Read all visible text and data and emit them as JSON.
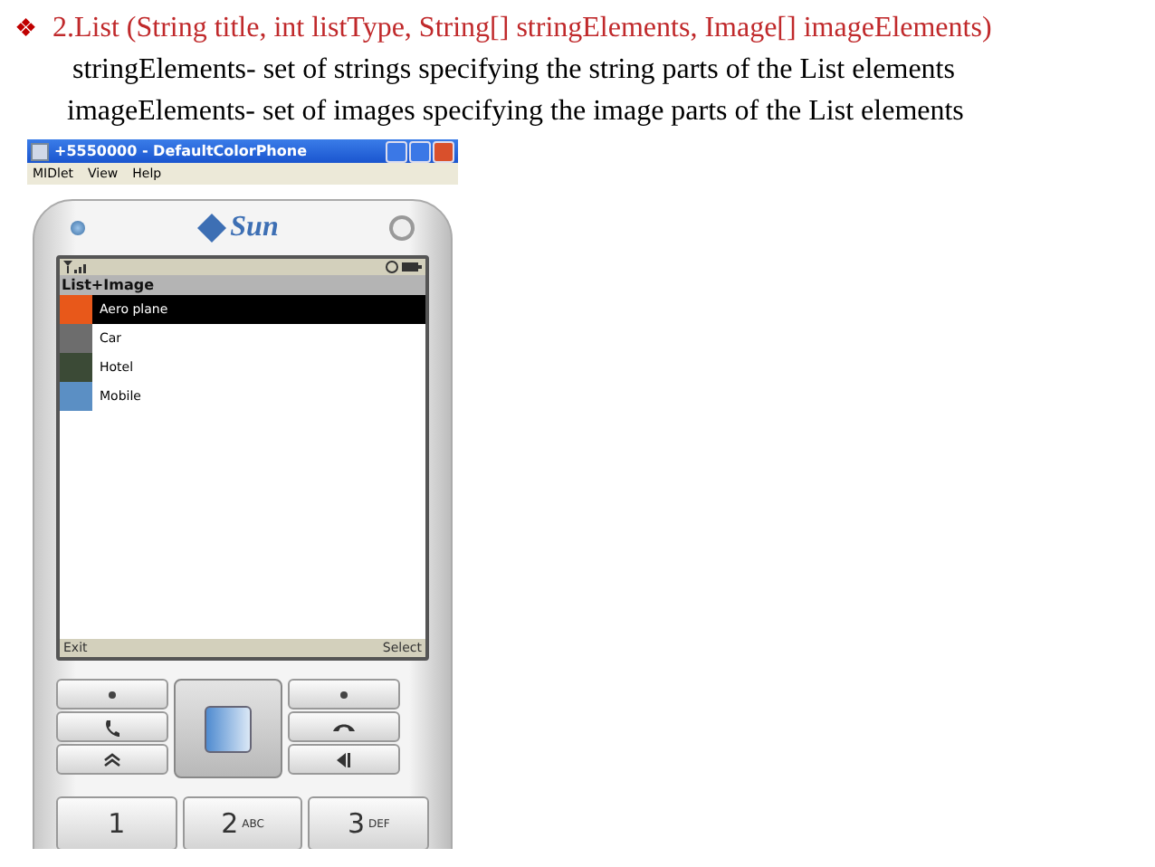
{
  "slide": {
    "bullet": "❖",
    "heading": "2.List (String title, int listType, String[] stringElements, Image[] imageElements)",
    "lines": [
      "stringElements- set of strings specifying the string parts of the List elements",
      "imageElements- set of images specifying the image parts of the List elements"
    ]
  },
  "emulator": {
    "title": "+5550000 - DefaultColorPhone",
    "menu": [
      "MIDlet",
      "View",
      "Help"
    ],
    "logo": "Sun",
    "screen": {
      "title": "List+Image",
      "items": [
        {
          "label": "Aero plane",
          "selected": true
        },
        {
          "label": "Car",
          "selected": false
        },
        {
          "label": "Hotel",
          "selected": false
        },
        {
          "label": "Mobile",
          "selected": false
        }
      ],
      "soft_left": "Exit",
      "soft_right": "Select"
    },
    "keys": [
      {
        "digit": "1"
      },
      {
        "digit": "2",
        "letters": "ABC"
      },
      {
        "digit": "3",
        "letters": "DEF"
      }
    ]
  }
}
